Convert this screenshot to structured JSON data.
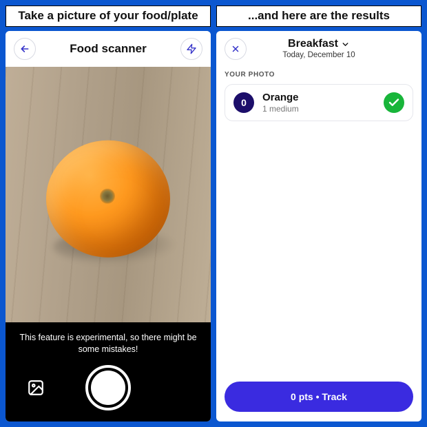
{
  "captions": {
    "left": "Take a picture of your food/plate",
    "right": "...and here are the results"
  },
  "scanner": {
    "title": "Food scanner",
    "disclaimer": "This feature is experimental, so there might be some mistakes!",
    "icons": {
      "back": "back-arrow-icon",
      "flash": "lightning-icon",
      "gallery": "gallery-icon",
      "shutter": "camera-shutter-icon"
    }
  },
  "results": {
    "meal_label": "Breakfast",
    "date_label": "Today, December 10",
    "section_label": "YOUR PHOTO",
    "food": {
      "points": "0",
      "name": "Orange",
      "portion": "1  medium"
    },
    "track_button": "0 pts • Track",
    "icons": {
      "close": "close-icon",
      "chevron": "chevron-down-icon",
      "check": "check-icon"
    }
  }
}
